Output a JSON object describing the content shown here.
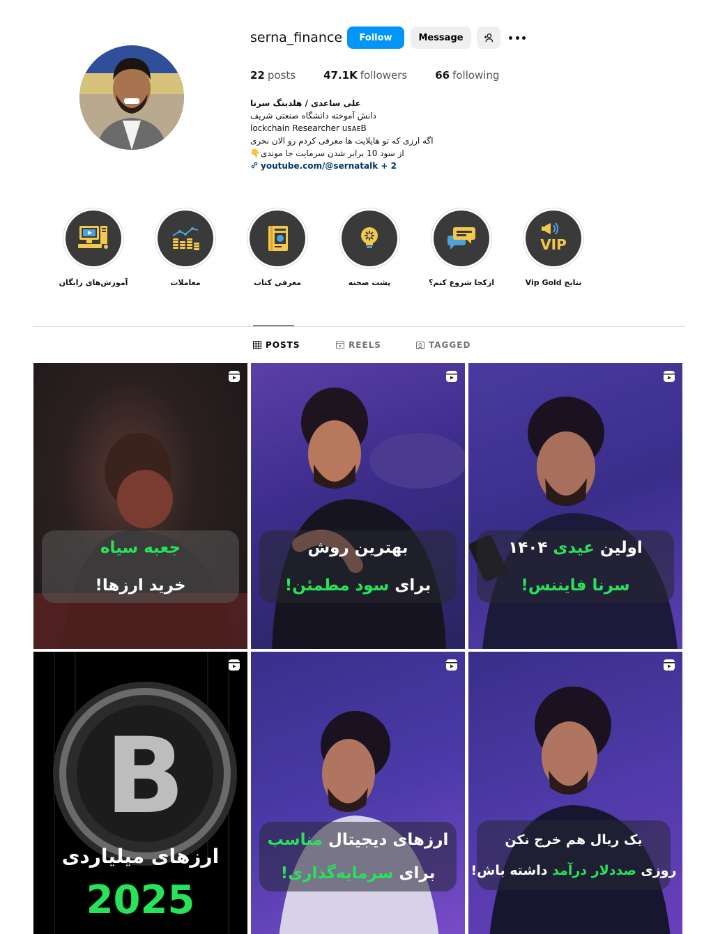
{
  "profile": {
    "username": "serna_finance",
    "follow_label": "Follow",
    "message_label": "Message",
    "stats": {
      "posts_count": "22",
      "posts_label": "posts",
      "followers_count": "47.1K",
      "followers_label": "followers",
      "following_count": "66",
      "following_label": "following"
    },
    "bio": {
      "name": "علی ساعدی / هلدینگ سرنا",
      "line1": "دانش آموخته دانشگاه صنعتی شریف",
      "line2": "lockchain Researcher usᴀᴇB",
      "line3": "اگه ارزی که تو هایلایت ها معرفی کردم رو الان نخری",
      "line4": "از سود 10 برابر شدن سرمایت جا موندی👇",
      "link": "youtube.com/@sernatalk",
      "link_extra": " + 2"
    }
  },
  "highlights": [
    {
      "label": "آموزش‌های رایگان",
      "icon": "computer-icon"
    },
    {
      "label": "معاملات",
      "icon": "trading-icon"
    },
    {
      "label": "معرفی کتاب",
      "icon": "book-icon"
    },
    {
      "label": "پشت صحنه",
      "icon": "lightbulb-icon"
    },
    {
      "label": "ازکجا شروع کنم؟",
      "icon": "chat-icon"
    },
    {
      "label": "نتایج Vip Gold",
      "icon": "vip-icon"
    }
  ],
  "tabs": {
    "posts": "POSTS",
    "reels": "REELS",
    "tagged": "TAGGED"
  },
  "posts": [
    {
      "line1_a": "",
      "line1_g": "جعبه سیاه",
      "line1_b": "",
      "line2_a": "خرید ارزها!",
      "line2_g": "",
      "line2_b": ""
    },
    {
      "line1_a": "بهترین روش",
      "line1_g": "",
      "line1_b": "",
      "line2_a": "برای ",
      "line2_g": "سود مطمئن!",
      "line2_b": ""
    },
    {
      "line1_a": "اولین ",
      "line1_g": "عیدی",
      "line1_b": " ۱۴۰۴",
      "line2_a": "",
      "line2_g": "سرنا فایننس!",
      "line2_b": ""
    },
    {
      "line1_a": "ارزهای میلیاردی",
      "line1_g": "",
      "line1_b": "",
      "line2_a": "",
      "line2_g": "2025",
      "line2_b": ""
    },
    {
      "line1_a": "ارزهای دیجیتال ",
      "line1_g": "مناسب",
      "line1_b": "",
      "line2_a": "برای ",
      "line2_g": "سرمایه‌گذاری!",
      "line2_b": ""
    },
    {
      "line1_a": "یک ریال هم خرج نکن",
      "line1_g": "",
      "line1_b": "",
      "line2_a": "روزی ",
      "line2_g": "صددلار درآمد",
      "line2_b": " داشته باش!"
    }
  ],
  "colors": {
    "follow_blue": "#0095f6",
    "accent_green": "#27e35a",
    "highlight_bg": "#3a3a3a",
    "icon_yellow": "#f2c94c"
  }
}
